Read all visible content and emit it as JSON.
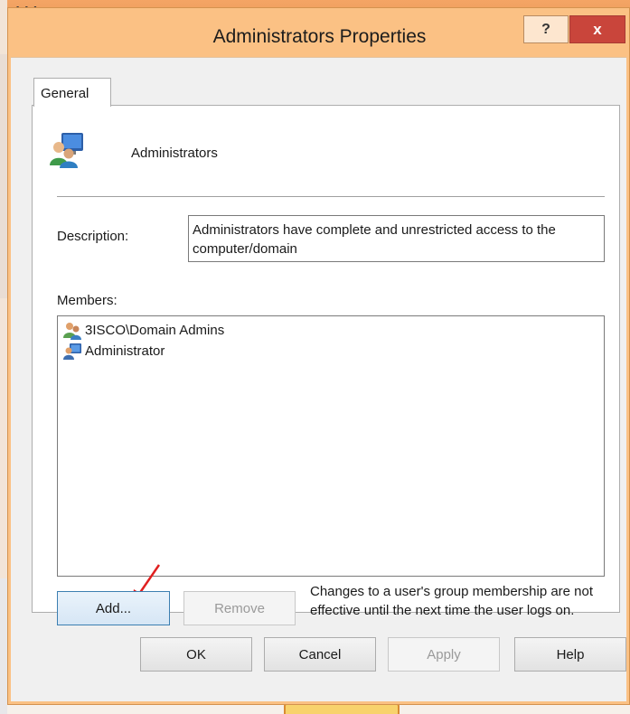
{
  "window": {
    "title": "Administrators Properties",
    "help_glyph": "?",
    "close_glyph": "x"
  },
  "tabs": [
    {
      "label": "General",
      "selected": true
    }
  ],
  "general": {
    "group_name": "Administrators",
    "group_icon": "users-icon",
    "description_label": "Description:",
    "description_value": "Administrators have complete and unrestricted access to the computer/domain",
    "members_label": "Members:",
    "members": [
      {
        "name": "3ISCO\\Domain Admins",
        "icon": "group-icon"
      },
      {
        "name": "Administrator",
        "icon": "user-icon"
      }
    ],
    "add_label": "Add...",
    "remove_label": "Remove",
    "notice": "Changes to a user's group membership are not effective until the next time the user logs on."
  },
  "buttons": {
    "ok": "OK",
    "cancel": "Cancel",
    "apply": "Apply",
    "help": "Help"
  },
  "colors": {
    "title_bar": "#fbc184",
    "close_button": "#c9453b",
    "annotation_arrow": "#e02020",
    "add_button_border": "#3c7fb1"
  }
}
